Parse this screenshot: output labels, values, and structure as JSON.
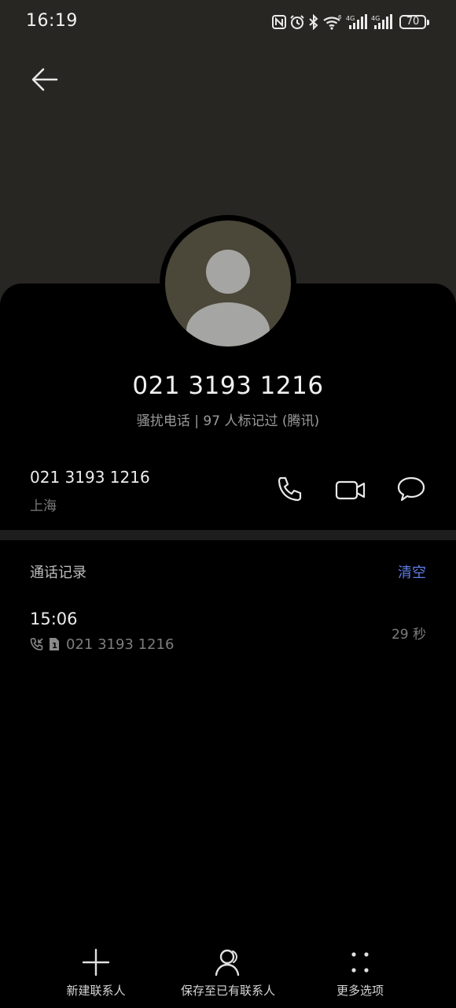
{
  "status_bar": {
    "time": "16:19",
    "icons": [
      "nfc-icon",
      "alarm-icon",
      "bluetooth-icon",
      "wifi-icon",
      "signal-4g-sim1-icon",
      "signal-4g-sim2-icon"
    ],
    "battery_level": "70"
  },
  "header": {
    "back_icon": "arrow-left-icon"
  },
  "contact": {
    "avatar_icon": "person-silhouette-icon",
    "number_title": "021 3193 1216",
    "tag_line": "骚扰电话 | 97 人标记过 (腾讯)"
  },
  "phone_row": {
    "number": "021 3193 1216",
    "location": "上海",
    "actions": [
      "phone-icon",
      "video-call-icon",
      "message-icon"
    ]
  },
  "call_log": {
    "title": "通话记录",
    "clear_label": "清空",
    "entries": [
      {
        "time": "15:06",
        "type_icon": "incoming-call-icon",
        "sim_icon": "sim-1-icon",
        "number": "021 3193 1216",
        "duration": "29 秒"
      }
    ]
  },
  "bottom_bar": {
    "new_contact_label": "新建联系人",
    "save_existing_label": "保存至已有联系人",
    "more_options_label": "更多选项"
  },
  "colors": {
    "header_band": "#272623",
    "background": "#000000",
    "avatar_bg": "#4b4739",
    "accent_link": "#5e7de6",
    "divider": "#1e1e1e"
  }
}
